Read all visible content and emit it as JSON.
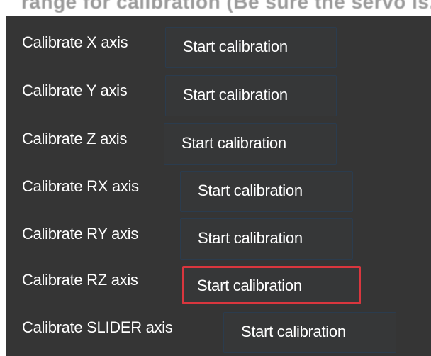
{
  "header": {
    "partial_title": "range for calibration (Be sure the servo is..."
  },
  "calibration": {
    "rows": [
      {
        "label": "Calibrate X axis",
        "button": "Start calibration",
        "highlighted": false
      },
      {
        "label": "Calibrate Y axis",
        "button": "Start calibration",
        "highlighted": false
      },
      {
        "label": "Calibrate Z axis",
        "button": "Start calibration",
        "highlighted": false
      },
      {
        "label": "Calibrate RX axis",
        "button": "Start calibration",
        "highlighted": false
      },
      {
        "label": "Calibrate RY axis",
        "button": "Start calibration",
        "highlighted": false
      },
      {
        "label": "Calibrate RZ axis",
        "button": "Start calibration",
        "highlighted": true
      },
      {
        "label": "Calibrate SLIDER axis",
        "button": "Start calibration",
        "highlighted": false
      }
    ]
  },
  "colors": {
    "panel_background": "#353535",
    "button_border": "#2b3c4e",
    "highlight_border": "#d9363e",
    "text": "#ffffff"
  }
}
